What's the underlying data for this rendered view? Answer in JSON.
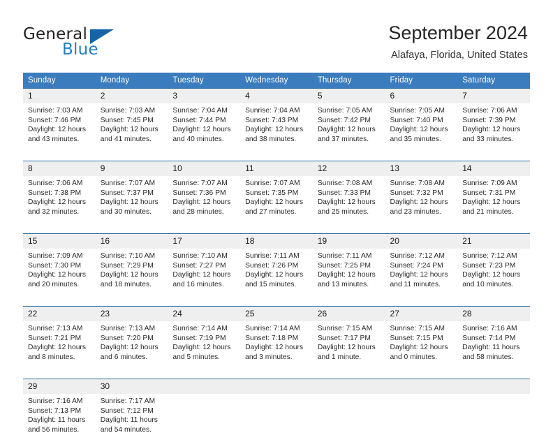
{
  "brand": {
    "name_part1": "General",
    "name_part2": "Blue",
    "logo_icon": "triangle-logo-icon"
  },
  "header": {
    "title": "September 2024",
    "location": "Alafaya, Florida, United States"
  },
  "colors": {
    "header_blue": "#3a7cbe",
    "rule_blue": "#2e6da4",
    "number_band": "#efefef",
    "brand_blue": "#1f7fc4",
    "text": "#222222"
  },
  "weekdays": [
    "Sunday",
    "Monday",
    "Tuesday",
    "Wednesday",
    "Thursday",
    "Friday",
    "Saturday"
  ],
  "weeks": [
    {
      "days": [
        {
          "num": "1",
          "sunrise": "Sunrise: 7:03 AM",
          "sunset": "Sunset: 7:46 PM",
          "daylight1": "Daylight: 12 hours",
          "daylight2": "and 43 minutes."
        },
        {
          "num": "2",
          "sunrise": "Sunrise: 7:03 AM",
          "sunset": "Sunset: 7:45 PM",
          "daylight1": "Daylight: 12 hours",
          "daylight2": "and 41 minutes."
        },
        {
          "num": "3",
          "sunrise": "Sunrise: 7:04 AM",
          "sunset": "Sunset: 7:44 PM",
          "daylight1": "Daylight: 12 hours",
          "daylight2": "and 40 minutes."
        },
        {
          "num": "4",
          "sunrise": "Sunrise: 7:04 AM",
          "sunset": "Sunset: 7:43 PM",
          "daylight1": "Daylight: 12 hours",
          "daylight2": "and 38 minutes."
        },
        {
          "num": "5",
          "sunrise": "Sunrise: 7:05 AM",
          "sunset": "Sunset: 7:42 PM",
          "daylight1": "Daylight: 12 hours",
          "daylight2": "and 37 minutes."
        },
        {
          "num": "6",
          "sunrise": "Sunrise: 7:05 AM",
          "sunset": "Sunset: 7:40 PM",
          "daylight1": "Daylight: 12 hours",
          "daylight2": "and 35 minutes."
        },
        {
          "num": "7",
          "sunrise": "Sunrise: 7:06 AM",
          "sunset": "Sunset: 7:39 PM",
          "daylight1": "Daylight: 12 hours",
          "daylight2": "and 33 minutes."
        }
      ]
    },
    {
      "days": [
        {
          "num": "8",
          "sunrise": "Sunrise: 7:06 AM",
          "sunset": "Sunset: 7:38 PM",
          "daylight1": "Daylight: 12 hours",
          "daylight2": "and 32 minutes."
        },
        {
          "num": "9",
          "sunrise": "Sunrise: 7:07 AM",
          "sunset": "Sunset: 7:37 PM",
          "daylight1": "Daylight: 12 hours",
          "daylight2": "and 30 minutes."
        },
        {
          "num": "10",
          "sunrise": "Sunrise: 7:07 AM",
          "sunset": "Sunset: 7:36 PM",
          "daylight1": "Daylight: 12 hours",
          "daylight2": "and 28 minutes."
        },
        {
          "num": "11",
          "sunrise": "Sunrise: 7:07 AM",
          "sunset": "Sunset: 7:35 PM",
          "daylight1": "Daylight: 12 hours",
          "daylight2": "and 27 minutes."
        },
        {
          "num": "12",
          "sunrise": "Sunrise: 7:08 AM",
          "sunset": "Sunset: 7:33 PM",
          "daylight1": "Daylight: 12 hours",
          "daylight2": "and 25 minutes."
        },
        {
          "num": "13",
          "sunrise": "Sunrise: 7:08 AM",
          "sunset": "Sunset: 7:32 PM",
          "daylight1": "Daylight: 12 hours",
          "daylight2": "and 23 minutes."
        },
        {
          "num": "14",
          "sunrise": "Sunrise: 7:09 AM",
          "sunset": "Sunset: 7:31 PM",
          "daylight1": "Daylight: 12 hours",
          "daylight2": "and 21 minutes."
        }
      ]
    },
    {
      "days": [
        {
          "num": "15",
          "sunrise": "Sunrise: 7:09 AM",
          "sunset": "Sunset: 7:30 PM",
          "daylight1": "Daylight: 12 hours",
          "daylight2": "and 20 minutes."
        },
        {
          "num": "16",
          "sunrise": "Sunrise: 7:10 AM",
          "sunset": "Sunset: 7:29 PM",
          "daylight1": "Daylight: 12 hours",
          "daylight2": "and 18 minutes."
        },
        {
          "num": "17",
          "sunrise": "Sunrise: 7:10 AM",
          "sunset": "Sunset: 7:27 PM",
          "daylight1": "Daylight: 12 hours",
          "daylight2": "and 16 minutes."
        },
        {
          "num": "18",
          "sunrise": "Sunrise: 7:11 AM",
          "sunset": "Sunset: 7:26 PM",
          "daylight1": "Daylight: 12 hours",
          "daylight2": "and 15 minutes."
        },
        {
          "num": "19",
          "sunrise": "Sunrise: 7:11 AM",
          "sunset": "Sunset: 7:25 PM",
          "daylight1": "Daylight: 12 hours",
          "daylight2": "and 13 minutes."
        },
        {
          "num": "20",
          "sunrise": "Sunrise: 7:12 AM",
          "sunset": "Sunset: 7:24 PM",
          "daylight1": "Daylight: 12 hours",
          "daylight2": "and 11 minutes."
        },
        {
          "num": "21",
          "sunrise": "Sunrise: 7:12 AM",
          "sunset": "Sunset: 7:23 PM",
          "daylight1": "Daylight: 12 hours",
          "daylight2": "and 10 minutes."
        }
      ]
    },
    {
      "days": [
        {
          "num": "22",
          "sunrise": "Sunrise: 7:13 AM",
          "sunset": "Sunset: 7:21 PM",
          "daylight1": "Daylight: 12 hours",
          "daylight2": "and 8 minutes."
        },
        {
          "num": "23",
          "sunrise": "Sunrise: 7:13 AM",
          "sunset": "Sunset: 7:20 PM",
          "daylight1": "Daylight: 12 hours",
          "daylight2": "and 6 minutes."
        },
        {
          "num": "24",
          "sunrise": "Sunrise: 7:14 AM",
          "sunset": "Sunset: 7:19 PM",
          "daylight1": "Daylight: 12 hours",
          "daylight2": "and 5 minutes."
        },
        {
          "num": "25",
          "sunrise": "Sunrise: 7:14 AM",
          "sunset": "Sunset: 7:18 PM",
          "daylight1": "Daylight: 12 hours",
          "daylight2": "and 3 minutes."
        },
        {
          "num": "26",
          "sunrise": "Sunrise: 7:15 AM",
          "sunset": "Sunset: 7:17 PM",
          "daylight1": "Daylight: 12 hours",
          "daylight2": "and 1 minute."
        },
        {
          "num": "27",
          "sunrise": "Sunrise: 7:15 AM",
          "sunset": "Sunset: 7:15 PM",
          "daylight1": "Daylight: 12 hours",
          "daylight2": "and 0 minutes."
        },
        {
          "num": "28",
          "sunrise": "Sunrise: 7:16 AM",
          "sunset": "Sunset: 7:14 PM",
          "daylight1": "Daylight: 11 hours",
          "daylight2": "and 58 minutes."
        }
      ]
    },
    {
      "days": [
        {
          "num": "29",
          "sunrise": "Sunrise: 7:16 AM",
          "sunset": "Sunset: 7:13 PM",
          "daylight1": "Daylight: 11 hours",
          "daylight2": "and 56 minutes."
        },
        {
          "num": "30",
          "sunrise": "Sunrise: 7:17 AM",
          "sunset": "Sunset: 7:12 PM",
          "daylight1": "Daylight: 11 hours",
          "daylight2": "and 54 minutes."
        },
        {
          "num": "",
          "sunrise": "",
          "sunset": "",
          "daylight1": "",
          "daylight2": ""
        },
        {
          "num": "",
          "sunrise": "",
          "sunset": "",
          "daylight1": "",
          "daylight2": ""
        },
        {
          "num": "",
          "sunrise": "",
          "sunset": "",
          "daylight1": "",
          "daylight2": ""
        },
        {
          "num": "",
          "sunrise": "",
          "sunset": "",
          "daylight1": "",
          "daylight2": ""
        },
        {
          "num": "",
          "sunrise": "",
          "sunset": "",
          "daylight1": "",
          "daylight2": ""
        }
      ]
    }
  ]
}
